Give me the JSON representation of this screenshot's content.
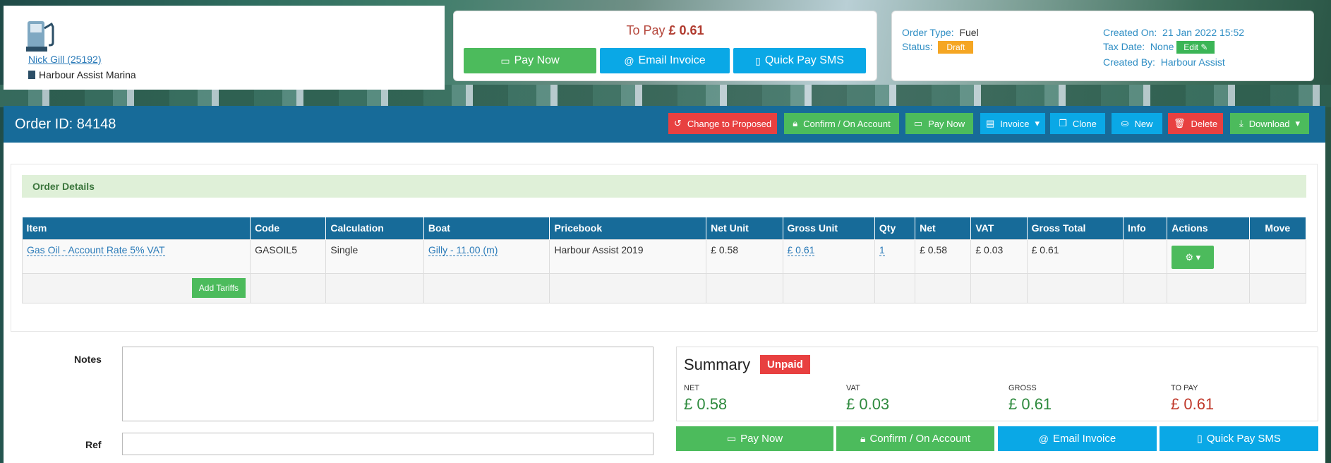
{
  "customer": {
    "name_link": "Nick Gill (25192)",
    "marina": "Harbour Assist Marina"
  },
  "pay_panel": {
    "to_pay_label": "To Pay",
    "to_pay_amount": "£ 0.61",
    "buttons": {
      "pay_now": "Pay Now",
      "email_invoice": "Email Invoice",
      "quick_pay_sms": "Quick Pay SMS"
    }
  },
  "meta": {
    "order_type_label": "Order Type:",
    "order_type_value": "Fuel",
    "status_label": "Status:",
    "status_value": "Draft",
    "created_on_label": "Created On:",
    "created_on_value": "21 Jan 2022 15:52",
    "tax_date_label": "Tax Date:",
    "tax_date_value": "None",
    "edit_label": "Edit",
    "created_by_label": "Created By:",
    "created_by_value": "Harbour Assist"
  },
  "toolbar": {
    "order_id": "Order ID: 84148",
    "change_to_proposed": "Change to Proposed",
    "confirm_on_account": "Confirm / On Account",
    "pay_now": "Pay Now",
    "invoice": "Invoice",
    "clone": "Clone",
    "new": "New",
    "delete": "Delete",
    "download": "Download"
  },
  "order_details": {
    "title": "Order Details",
    "columns": [
      "Item",
      "Code",
      "Calculation",
      "Boat",
      "Pricebook",
      "Net Unit",
      "Gross Unit",
      "Qty",
      "Net",
      "VAT",
      "Gross Total",
      "Info",
      "Actions",
      "Move"
    ],
    "rows": [
      {
        "item": "Gas Oil - Account Rate 5% VAT",
        "code": "GASOIL5",
        "calculation": "Single",
        "boat": "Gilly - 11.00 (m)",
        "pricebook": "Harbour Assist 2019",
        "net_unit": "£ 0.58",
        "gross_unit": "£ 0.61",
        "qty": "1",
        "net": "£ 0.58",
        "vat": "£ 0.03",
        "gross_total": "£ 0.61",
        "info": ""
      }
    ],
    "add_tariffs": "Add Tariffs"
  },
  "notes": {
    "notes_label": "Notes",
    "notes_value": "",
    "ref_label": "Ref",
    "ref_value": ""
  },
  "summary": {
    "title": "Summary",
    "badge": "Unpaid",
    "net_label": "NET",
    "net_value": "£ 0.58",
    "vat_label": "VAT",
    "vat_value": "£ 0.03",
    "gross_label": "GROSS",
    "gross_value": "£ 0.61",
    "to_pay_label": "TO PAY",
    "to_pay_value": "£ 0.61"
  },
  "bottom_buttons": {
    "pay_now": "Pay Now",
    "confirm_on_account": "Confirm / On Account",
    "email_invoice": "Email Invoice",
    "quick_pay_sms": "Quick Pay SMS"
  },
  "colors": {
    "header_blue": "#176b99",
    "green": "#4cbb5c",
    "light_blue": "#0aa8e6",
    "red": "#e84040",
    "draft_orange": "#f5a623"
  }
}
